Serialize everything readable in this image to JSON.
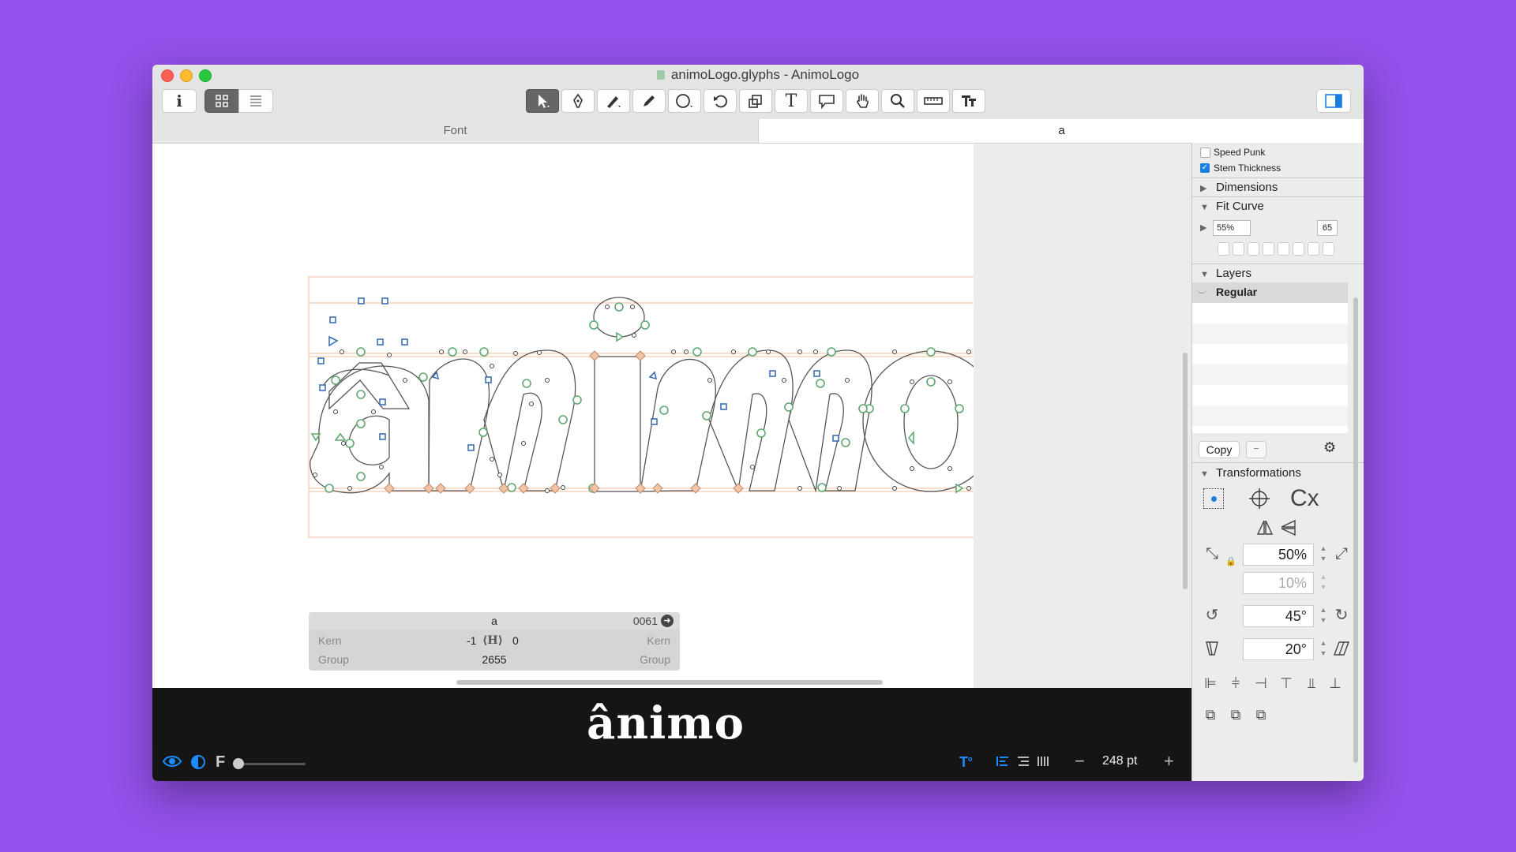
{
  "window": {
    "title": "animoLogo.glyphs - AnimoLogo"
  },
  "tabs": [
    {
      "label": "Font"
    },
    {
      "label": "a"
    }
  ],
  "info_panel": {
    "glyph_name": "a",
    "unicode": "0061",
    "left_label": "Kern",
    "right_label": "Kern",
    "kern_left": "-1",
    "kern_right": "0",
    "group_left_label": "Group",
    "group_right_label": "Group",
    "width": "2655"
  },
  "preview": {
    "text": "ânimo",
    "font_size": "248 pt"
  },
  "sidebar": {
    "palette": [
      {
        "label": "Speed Punk",
        "checked": false
      },
      {
        "label": "Stem Thickness",
        "checked": true
      }
    ],
    "dimensions_label": "Dimensions",
    "fit_curve": {
      "label": "Fit Curve",
      "min": "55%",
      "max": "65"
    },
    "layers": {
      "label": "Layers",
      "items": [
        "Regular"
      ]
    },
    "copy_button": "Copy",
    "transformations": {
      "label": "Transformations",
      "origin_text": "Cx",
      "scale": "50%",
      "scale_secondary": "10%",
      "rotate": "45°",
      "slant": "20°"
    }
  },
  "colors": {
    "desktop": "#9450ea",
    "accent_blue": "#1a8cff",
    "node_green": "#5fa86f",
    "node_blue": "#3e6fb3",
    "metric_line": "#f4c9ae"
  }
}
